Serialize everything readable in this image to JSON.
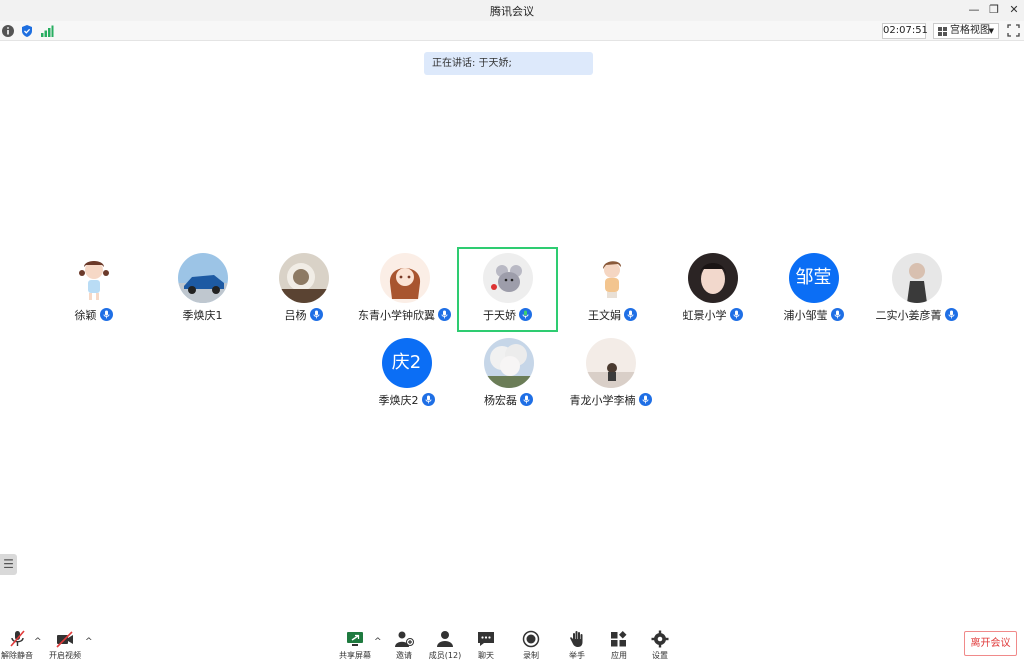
{
  "window": {
    "title": "腾讯会议"
  },
  "statusbar": {
    "timer": "02:07:51",
    "view_label": "宫格视图"
  },
  "speaking_banner": "正在讲话: 于天娇;",
  "participants_row1": [
    {
      "name": "徐颖",
      "avatar": "cartoon-girl-avatar"
    },
    {
      "name": "季焕庆1",
      "avatar": "car-photo-avatar"
    },
    {
      "name": "吕杨",
      "avatar": "photo-avatar"
    },
    {
      "name": "东青小学钟欣翼",
      "avatar": "anime-girl-avatar"
    },
    {
      "name": "于天娇",
      "avatar": "mouse-cartoon-avatar",
      "speaking": true
    },
    {
      "name": "王文娟",
      "avatar": "cartoon-girl-avatar"
    },
    {
      "name": "虹景小学",
      "avatar": "portrait-avatar"
    },
    {
      "name": "浦小邹莹",
      "avatar_text": "邹莹"
    },
    {
      "name": "二实小姜彦菁",
      "avatar": "portrait-avatar"
    }
  ],
  "participants_row2": [
    {
      "name": "季焕庆2",
      "avatar_text": "庆2"
    },
    {
      "name": "杨宏磊",
      "avatar": "tree-photo-avatar"
    },
    {
      "name": "青龙小学李楠",
      "avatar": "portrait-avatar"
    }
  ],
  "toolbar": {
    "unmute": "解除静音",
    "start_video": "开启视频",
    "share_screen": "共享屏幕",
    "invite": "邀请",
    "members": "成员(12)",
    "chat": "聊天",
    "record": "录制",
    "raise_hand": "举手",
    "apps": "应用",
    "settings": "设置",
    "leave": "离开会议"
  },
  "colors": {
    "accent": "#0b6ef5",
    "speaking_border": "#2ecc71",
    "leave": "#e03a3a"
  }
}
